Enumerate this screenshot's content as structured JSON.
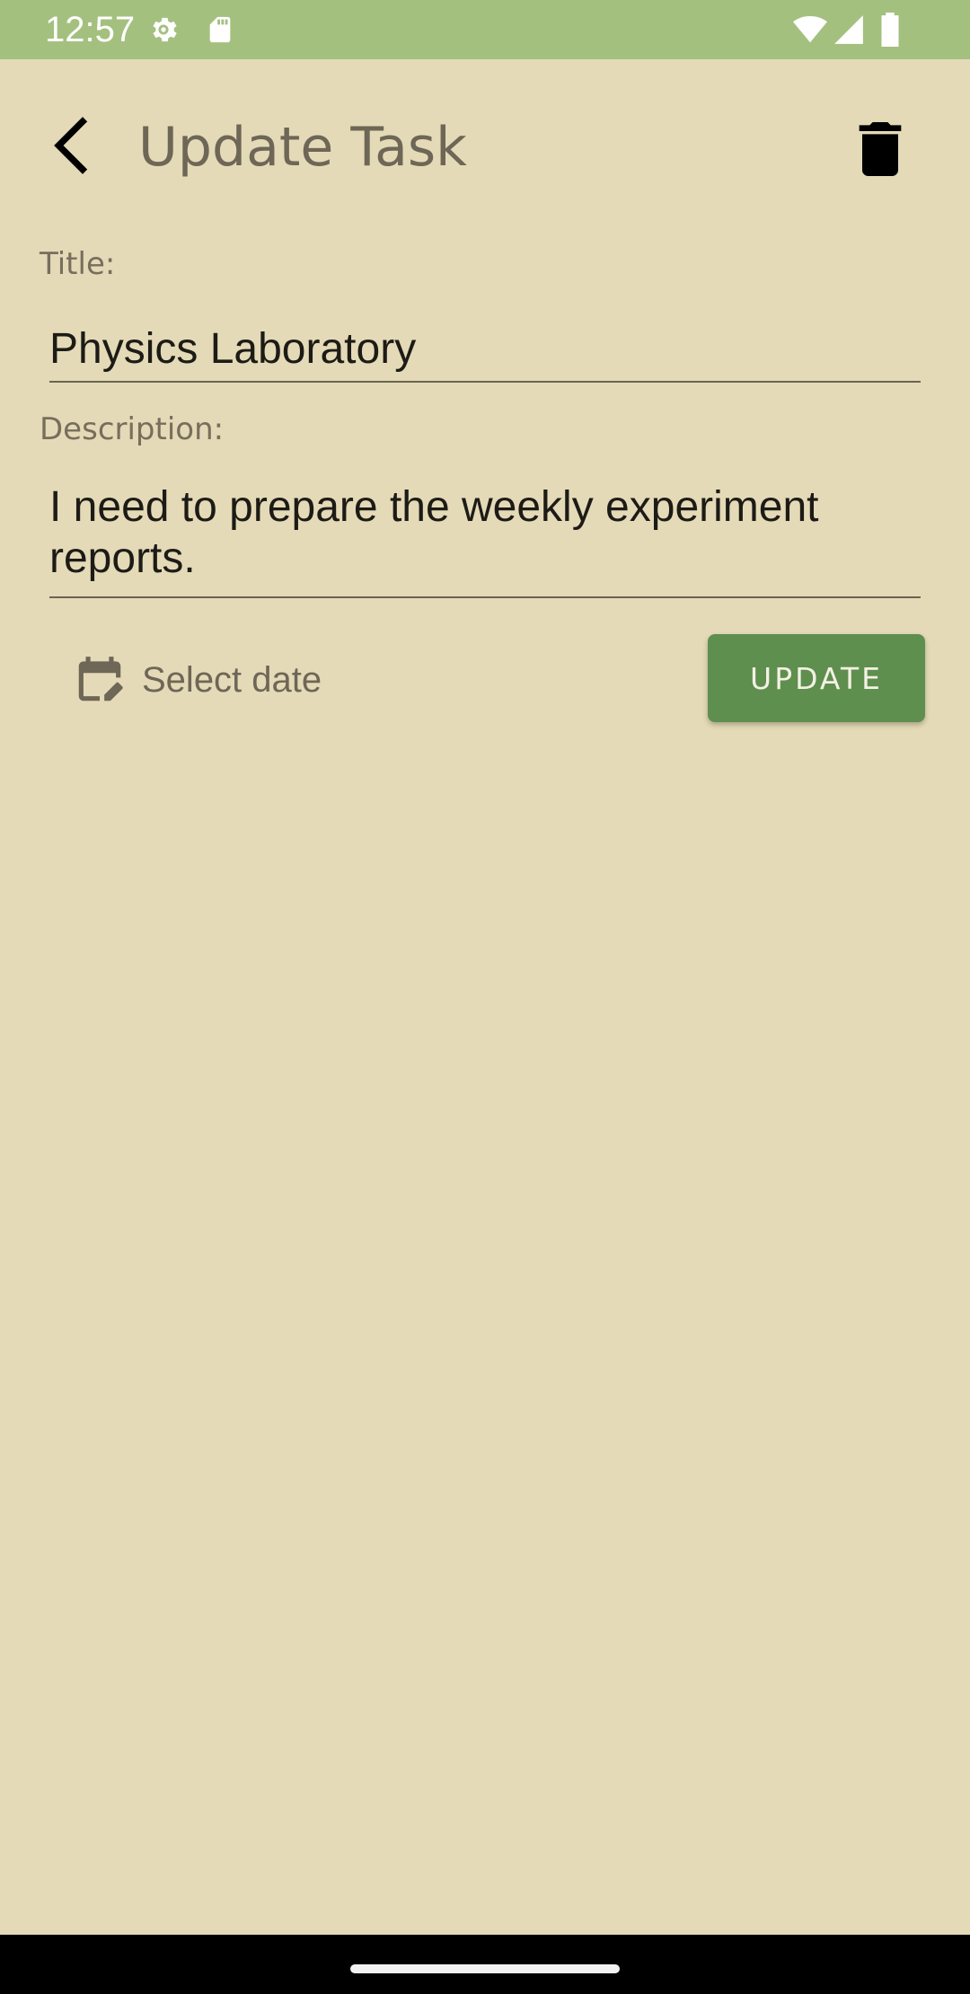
{
  "status_bar": {
    "time": "12:57",
    "left_icons": [
      "gear-icon",
      "sd-card-icon"
    ],
    "right_icons": [
      "wifi-icon",
      "cell-signal-icon",
      "battery-icon"
    ],
    "background": "#A4C07F"
  },
  "app_bar": {
    "title": "Update Task",
    "back_icon": "back-arrow-icon",
    "delete_icon": "trash-icon"
  },
  "form": {
    "title_label": "Title:",
    "title_value": "Physics Laboratory",
    "description_label": "Description:",
    "description_value": "I need to prepare the weekly experiment reports.",
    "date_icon": "calendar-edit-icon",
    "date_label": "Select date",
    "submit_label": "UPDATE"
  },
  "colors": {
    "background": "#E4DAB7",
    "accent": "#5E8F4E",
    "title_text": "#6E6656"
  }
}
